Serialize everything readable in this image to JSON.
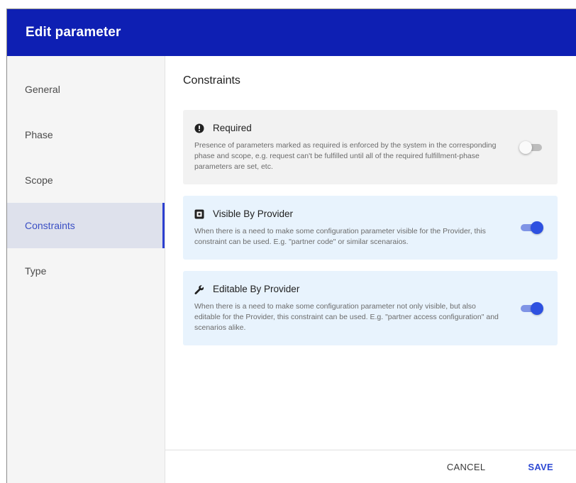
{
  "dialog": {
    "title": "Edit parameter"
  },
  "sidebar": {
    "items": [
      {
        "label": "General",
        "active": false
      },
      {
        "label": "Phase",
        "active": false
      },
      {
        "label": "Scope",
        "active": false
      },
      {
        "label": "Constraints",
        "active": true
      },
      {
        "label": "Type",
        "active": false
      }
    ]
  },
  "main": {
    "section_title": "Constraints",
    "cards": [
      {
        "icon": "exclamation-circle-icon",
        "title": "Required",
        "description": "Presence of parameters marked as required is enforced by the system in the corresponding phase and scope, e.g. request can't be fulfilled until all of the required fulfillment-phase parameters are set, etc.",
        "enabled": false
      },
      {
        "icon": "provider-badge-icon",
        "title": "Visible By Provider",
        "description": "When there is a need to make some configuration parameter visible for the Provider, this constraint can be used. E.g. \"partner code\" or similar scenaraios.",
        "enabled": true
      },
      {
        "icon": "wrench-icon",
        "title": "Editable By Provider",
        "description": "When there is a need to make some configuration parameter not only visible, but also editable for the Provider, this constraint can be used. E.g. \"partner access configuration\" and scenarios alike.",
        "enabled": true
      }
    ]
  },
  "footer": {
    "cancel_label": "CANCEL",
    "save_label": "SAVE"
  },
  "colors": {
    "header": "#0e1fb3",
    "accent": "#2e51e0",
    "active_nav_bg": "#dee1ec",
    "card_blue": "#e8f3fd",
    "card_gray": "#f2f2f2"
  }
}
